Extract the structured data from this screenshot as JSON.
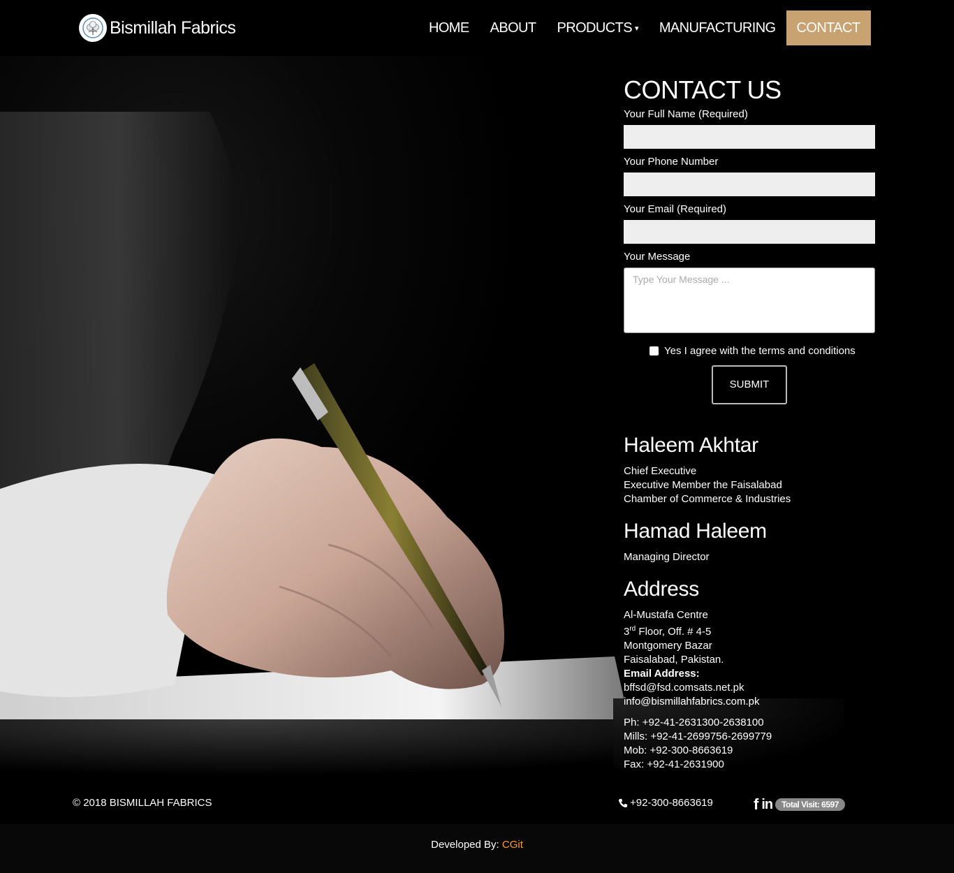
{
  "brand": {
    "name": "Bismillah Fabrics",
    "logo_icon": "cotton-flower-icon"
  },
  "nav": {
    "items": [
      "HOME",
      "ABOUT",
      "PRODUCTS",
      "MANUFACTURING",
      "CONTACT"
    ],
    "products_caret": "▾",
    "active": "CONTACT",
    "active_color": "#c8a271"
  },
  "contact": {
    "title": "CONTACT US",
    "fields": {
      "name_label": "Your Full Name (Required)",
      "name_value": "",
      "phone_label": "Your Phone Number",
      "phone_value": "",
      "email_label": "Your Email (Required)",
      "email_value": "",
      "message_label": "Your Message",
      "message_placeholder": "Type Your Message ..."
    },
    "agree_text": "Yes I agree with the terms and conditions",
    "agree_checked": false,
    "submit_label": "SUBMIT"
  },
  "people": [
    {
      "name": "Haleem Akhtar",
      "lines": [
        "Chief Executive",
        "Executive Member the Faisalabad",
        "Chamber of Commerce & Industries"
      ]
    },
    {
      "name": "Hamad Haleem",
      "lines": [
        "Managing Director"
      ]
    }
  ],
  "address": {
    "title": "Address",
    "line1": "Al-Mustafa Centre",
    "line2_num": "3",
    "line2_sup": "rd",
    "line2_rest": " Floor, Off. # 4-5",
    "line3": "Montgomery Bazar",
    "line4": "Faisalabad, Pakistan.",
    "email_heading": "Email Address:",
    "email1": "bffsd@fsd.comsats.net.pk",
    "email2": "info@bismillahfabrics.com.pk",
    "phones": [
      "Ph: +92-41-2631300-2638100",
      "Mills: +92-41-2699756-2699779",
      "Mob: +92-300-8663619",
      "Fax: +92-41-2631900"
    ]
  },
  "footer": {
    "copyright": "© 2018 BISMILLAH FABRICS",
    "phone": "+92-300-8663619",
    "phone_icon": "phone-icon",
    "facebook_icon": "facebook-icon",
    "linkedin_icon": "linkedin-icon",
    "visits": "Total Visit: 6597"
  },
  "credits": {
    "prefix": "Developed By: ",
    "developer": "CGit",
    "developer_color": "#ff9d1b"
  }
}
